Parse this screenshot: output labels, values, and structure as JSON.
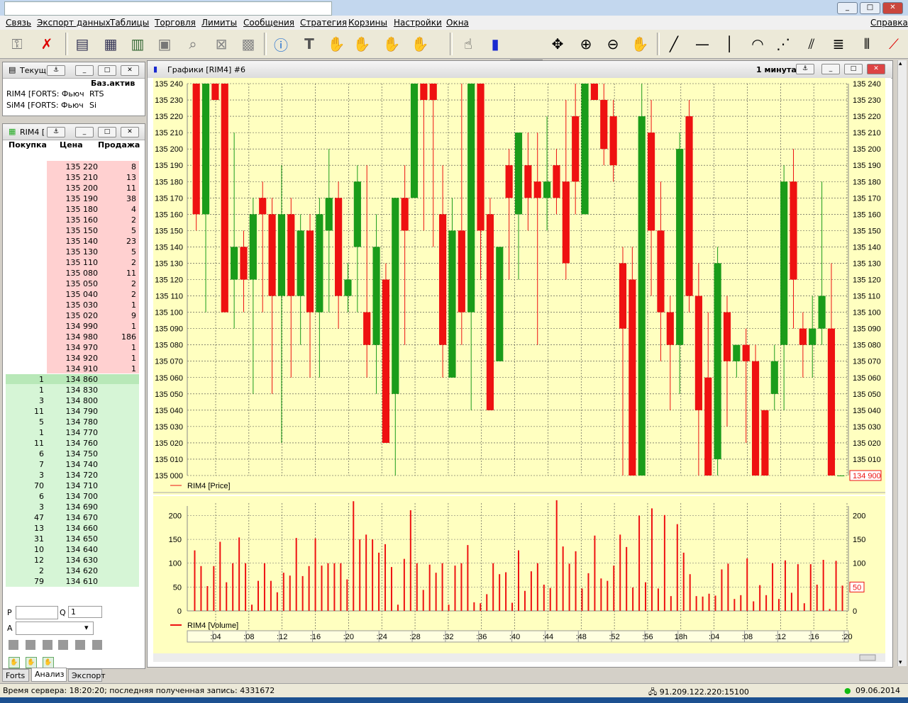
{
  "menu": [
    "Связь",
    "Экспорт данных",
    "Таблицы",
    "Торговля",
    "Лимиты",
    "Сообщения",
    "Стратегия",
    "Корзины",
    "Настройки",
    "Окна"
  ],
  "menu_right": "Справка",
  "toolbar": {
    "timeframe": "M1"
  },
  "current_panel": {
    "title": "Текущ",
    "col_header": "Баз.актив",
    "rows": [
      {
        "name": "RIM4 [FORTS: Фьюч",
        "base": "RTS"
      },
      {
        "name": "SiM4 [FORTS: Фьюч",
        "base": "Si"
      }
    ]
  },
  "orderbook": {
    "title": "RIM4 [",
    "headers": {
      "buy": "Покупка",
      "price": "Цена",
      "sell": "Продажа"
    },
    "asks": [
      {
        "price": "135 220",
        "qty": "8"
      },
      {
        "price": "135 210",
        "qty": "13"
      },
      {
        "price": "135 200",
        "qty": "11"
      },
      {
        "price": "135 190",
        "qty": "38"
      },
      {
        "price": "135 180",
        "qty": "4"
      },
      {
        "price": "135 160",
        "qty": "2"
      },
      {
        "price": "135 150",
        "qty": "5"
      },
      {
        "price": "135 140",
        "qty": "23"
      },
      {
        "price": "135 130",
        "qty": "5"
      },
      {
        "price": "135 110",
        "qty": "2"
      },
      {
        "price": "135 080",
        "qty": "11"
      },
      {
        "price": "135 050",
        "qty": "2"
      },
      {
        "price": "135 040",
        "qty": "2"
      },
      {
        "price": "135 030",
        "qty": "1"
      },
      {
        "price": "135 020",
        "qty": "9"
      },
      {
        "price": "134 990",
        "qty": "1"
      },
      {
        "price": "134 980",
        "qty": "186"
      },
      {
        "price": "134 970",
        "qty": "1"
      },
      {
        "price": "134 920",
        "qty": "1"
      },
      {
        "price": "134 910",
        "qty": "1"
      }
    ],
    "bids": [
      {
        "qty": "1",
        "price": "134 860"
      },
      {
        "qty": "1",
        "price": "134 830"
      },
      {
        "qty": "3",
        "price": "134 800"
      },
      {
        "qty": "11",
        "price": "134 790"
      },
      {
        "qty": "5",
        "price": "134 780"
      },
      {
        "qty": "1",
        "price": "134 770"
      },
      {
        "qty": "11",
        "price": "134 760"
      },
      {
        "qty": "6",
        "price": "134 750"
      },
      {
        "qty": "7",
        "price": "134 740"
      },
      {
        "qty": "3",
        "price": "134 720"
      },
      {
        "qty": "70",
        "price": "134 710"
      },
      {
        "qty": "6",
        "price": "134 700"
      },
      {
        "qty": "3",
        "price": "134 690"
      },
      {
        "qty": "47",
        "price": "134 670"
      },
      {
        "qty": "13",
        "price": "134 660"
      },
      {
        "qty": "31",
        "price": "134 650"
      },
      {
        "qty": "10",
        "price": "134 640"
      },
      {
        "qty": "12",
        "price": "134 630"
      },
      {
        "qty": "2",
        "price": "134 620"
      },
      {
        "qty": "79",
        "price": "134 610"
      }
    ],
    "p_label": "P",
    "q_label": "Q",
    "q_value": "1",
    "a_label": "A"
  },
  "tabs": [
    "Forts",
    "Анализ",
    "Экспорт"
  ],
  "chart": {
    "window_title": "Графики [RIM4] #6",
    "interval": "1 минута",
    "price_legend": "RIM4 [Price]",
    "volume_legend": "RIM4 [Volume]",
    "price_ticks": [
      "135 240",
      "135 230",
      "135 220",
      "135 210",
      "135 200",
      "135 190",
      "135 180",
      "135 170",
      "135 160",
      "135 150",
      "135 140",
      "135 130",
      "135 120",
      "135 110",
      "135 100",
      "135 090",
      "135 080",
      "135 070",
      "135 060",
      "135 050",
      "135 040",
      "135 030",
      "135 020",
      "135 010",
      "135 000"
    ],
    "current_price": "134 900",
    "volume_ticks": [
      "200",
      "150",
      "100",
      "50",
      "0"
    ],
    "current_volume": "50",
    "time_ticks": [
      ":04",
      ":08",
      ":12",
      ":16",
      ":20",
      ":24",
      ":28",
      ":32",
      ":36",
      ":40",
      ":44",
      ":48",
      ":52",
      ":56",
      "18h",
      ":04",
      ":08",
      ":12",
      ":16",
      ":20"
    ],
    "up_color": "#1a9c1a",
    "down_color": "#ee1111",
    "bg_color": "#ffffc0"
  },
  "chart_data": {
    "type": "candlestick",
    "price_range": [
      135000,
      135240
    ],
    "volume_range": [
      0,
      220
    ],
    "candles": [
      {
        "o": 135240,
        "c": 135160,
        "h": 135240,
        "l": 135150
      },
      {
        "o": 135160,
        "c": 135240,
        "h": 135240,
        "l": 135100
      },
      {
        "o": 135240,
        "c": 135230,
        "h": 135240,
        "l": 135230
      },
      {
        "o": 135240,
        "c": 135100,
        "h": 135240,
        "l": 135100
      },
      {
        "o": 135120,
        "c": 135140,
        "h": 135210,
        "l": 135090
      },
      {
        "o": 135140,
        "c": 135120,
        "h": 135150,
        "l": 135100
      },
      {
        "o": 135120,
        "c": 135160,
        "h": 135170,
        "l": 135050
      },
      {
        "o": 135170,
        "c": 135160,
        "h": 135180,
        "l": 135100
      },
      {
        "o": 135160,
        "c": 135110,
        "h": 135170,
        "l": 135050
      },
      {
        "o": 135110,
        "c": 135160,
        "h": 135190,
        "l": 135020
      },
      {
        "o": 135160,
        "c": 135110,
        "h": 135170,
        "l": 135060
      },
      {
        "o": 135110,
        "c": 135150,
        "h": 135160,
        "l": 135080
      },
      {
        "o": 135150,
        "c": 135100,
        "h": 135160,
        "l": 135060
      },
      {
        "o": 135100,
        "c": 135160,
        "h": 135170,
        "l": 135060
      },
      {
        "o": 135150,
        "c": 135170,
        "h": 135200,
        "l": 135100
      },
      {
        "o": 135170,
        "c": 135110,
        "h": 135180,
        "l": 135090
      },
      {
        "o": 135110,
        "c": 135120,
        "h": 135130,
        "l": 135100
      },
      {
        "o": 135140,
        "c": 135180,
        "h": 135190,
        "l": 135100
      },
      {
        "o": 135100,
        "c": 135080,
        "h": 135190,
        "l": 135060
      },
      {
        "o": 135080,
        "c": 135140,
        "h": 135160,
        "l": 135050
      },
      {
        "o": 135120,
        "c": 135020,
        "h": 135130,
        "l": 135020
      },
      {
        "o": 135050,
        "c": 135170,
        "h": 135170,
        "l": 135000
      },
      {
        "o": 135170,
        "c": 135150,
        "h": 135190,
        "l": 135080
      },
      {
        "o": 135170,
        "c": 135240,
        "h": 135240,
        "l": 135170
      },
      {
        "o": 135240,
        "c": 135230,
        "h": 135240,
        "l": 135150
      },
      {
        "o": 135240,
        "c": 135230,
        "h": 135240,
        "l": 135140
      },
      {
        "o": 135160,
        "c": 135080,
        "h": 135190,
        "l": 135060
      },
      {
        "o": 135060,
        "c": 135150,
        "h": 135170,
        "l": 135060
      },
      {
        "o": 135150,
        "c": 135100,
        "h": 135240,
        "l": 135080
      },
      {
        "o": 135100,
        "c": 135240,
        "h": 135240,
        "l": 135040
      },
      {
        "o": 135240,
        "c": 135150,
        "h": 135240,
        "l": 135120
      },
      {
        "o": 135160,
        "c": 135040,
        "h": 135170,
        "l": 135040
      },
      {
        "o": 135070,
        "c": 135140,
        "h": 135140,
        "l": 135070
      },
      {
        "o": 135190,
        "c": 135170,
        "h": 135200,
        "l": 135120
      },
      {
        "o": 135160,
        "c": 135210,
        "h": 135210,
        "l": 135120
      },
      {
        "o": 135190,
        "c": 135170,
        "h": 135210,
        "l": 135150
      },
      {
        "o": 135180,
        "c": 135170,
        "h": 135210,
        "l": 135080
      },
      {
        "o": 135170,
        "c": 135180,
        "h": 135220,
        "l": 135150
      },
      {
        "o": 135190,
        "c": 135170,
        "h": 135200,
        "l": 135160
      },
      {
        "o": 135180,
        "c": 135130,
        "h": 135230,
        "l": 135120
      },
      {
        "o": 135220,
        "c": 135180,
        "h": 135240,
        "l": 135160
      },
      {
        "o": 135160,
        "c": 135240,
        "h": 135240,
        "l": 135160
      },
      {
        "o": 135240,
        "c": 135230,
        "h": 135240,
        "l": 135230
      },
      {
        "o": 135230,
        "c": 135200,
        "h": 135240,
        "l": 135190
      },
      {
        "o": 135220,
        "c": 135190,
        "h": 135230,
        "l": 135180
      },
      {
        "o": 135130,
        "c": 135090,
        "h": 135140,
        "l": 135000
      },
      {
        "o": 135120,
        "c": 135000,
        "h": 135140,
        "l": 135000
      },
      {
        "o": 135000,
        "c": 135220,
        "h": 135240,
        "l": 135000
      },
      {
        "o": 135210,
        "c": 135150,
        "h": 135230,
        "l": 135110
      },
      {
        "o": 135150,
        "c": 135100,
        "h": 135180,
        "l": 135070
      },
      {
        "o": 135100,
        "c": 135080,
        "h": 135110,
        "l": 135040
      },
      {
        "o": 135080,
        "c": 135200,
        "h": 135210,
        "l": 135050
      },
      {
        "o": 135220,
        "c": 135110,
        "h": 135230,
        "l": 135100
      },
      {
        "o": 135110,
        "c": 135040,
        "h": 135130,
        "l": 135000
      },
      {
        "o": 135060,
        "c": 135000,
        "h": 135100,
        "l": 135000
      },
      {
        "o": 135010,
        "c": 135130,
        "h": 135140,
        "l": 135000
      },
      {
        "o": 135100,
        "c": 135070,
        "h": 135110,
        "l": 135030
      },
      {
        "o": 135070,
        "c": 135080,
        "h": 135080,
        "l": 135060
      },
      {
        "o": 135080,
        "c": 135070,
        "h": 135090,
        "l": 135020
      },
      {
        "o": 135070,
        "c": 135000,
        "h": 135080,
        "l": 135000
      },
      {
        "o": 135040,
        "c": 135000,
        "h": 135040,
        "l": 135000
      },
      {
        "o": 135050,
        "c": 135070,
        "h": 135080,
        "l": 135040
      },
      {
        "o": 135080,
        "c": 135180,
        "h": 135190,
        "l": 135040
      },
      {
        "o": 135180,
        "c": 135120,
        "h": 135200,
        "l": 135090
      },
      {
        "o": 135090,
        "c": 135080,
        "h": 135100,
        "l": 135060
      },
      {
        "o": 135080,
        "c": 135090,
        "h": 135110,
        "l": 135060
      },
      {
        "o": 135090,
        "c": 135110,
        "h": 135180,
        "l": 135080
      },
      {
        "o": 135090,
        "c": 135000,
        "h": 135130,
        "l": 135000
      },
      {
        "o": 135000,
        "c": 135000,
        "h": 135000,
        "l": 135000
      }
    ],
    "volumes": [
      127,
      94,
      52,
      94,
      145,
      60,
      100,
      154,
      100,
      13,
      63,
      100,
      63,
      39,
      80,
      74,
      153,
      73,
      94,
      152,
      95,
      100,
      100,
      100,
      66,
      230,
      150,
      160,
      150,
      122,
      140,
      92,
      13,
      109,
      211,
      100,
      44,
      97,
      80,
      100,
      13,
      95,
      100,
      138,
      18,
      16,
      35,
      100,
      77,
      81,
      17,
      127,
      42,
      83,
      100,
      55,
      48,
      232,
      135,
      99,
      125,
      47,
      79,
      158,
      68,
      63,
      95,
      160,
      134,
      49,
      200,
      60,
      215,
      47,
      201,
      31,
      182,
      122,
      77,
      31,
      30,
      36,
      32,
      87,
      99,
      25,
      33,
      110,
      20,
      54,
      33,
      100,
      25,
      106,
      38,
      98,
      16,
      98,
      55,
      107,
      4,
      105,
      53
    ]
  }
}
